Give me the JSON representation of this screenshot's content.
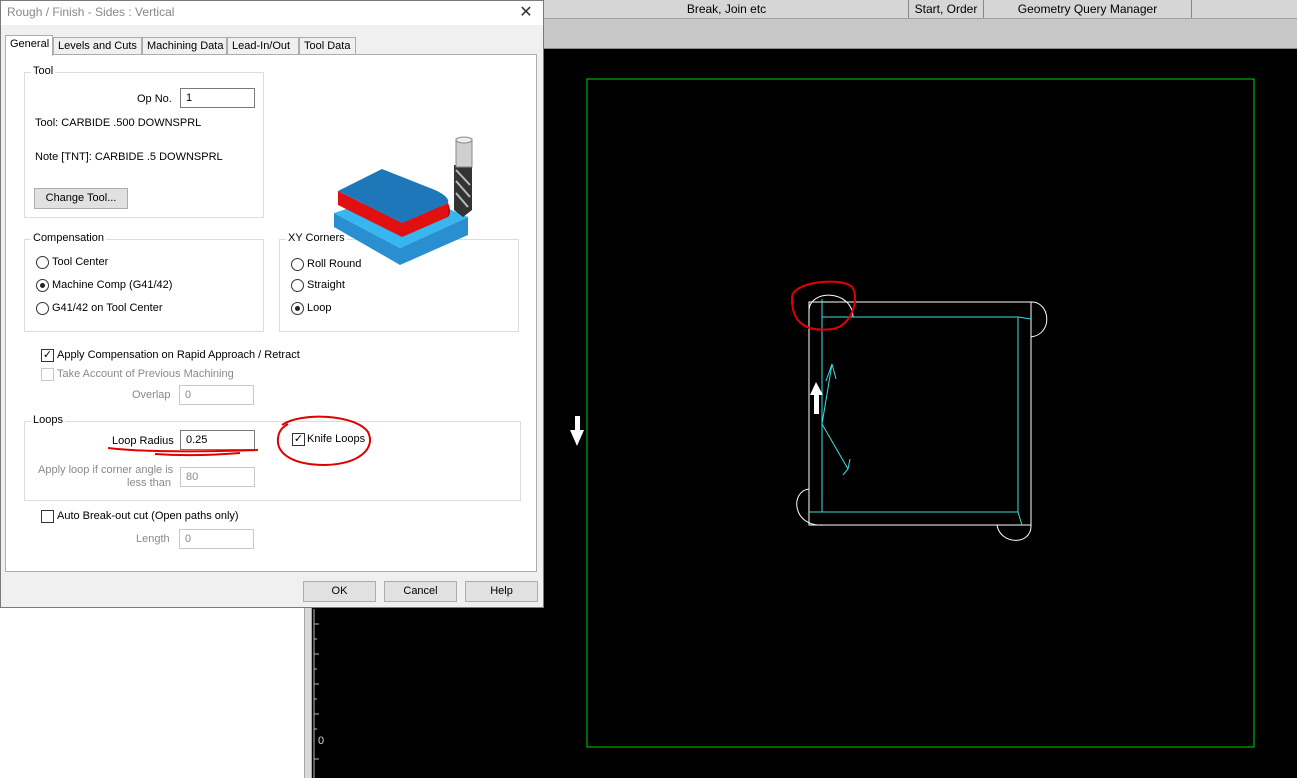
{
  "dialog": {
    "title": "Rough / Finish - Sides : Vertical",
    "close_glyph": "✕",
    "tabs": [
      {
        "label": "General"
      },
      {
        "label": "Levels and Cuts"
      },
      {
        "label": "Machining Data"
      },
      {
        "label": "Lead-In/Out"
      },
      {
        "label": "Tool Data"
      }
    ],
    "tool_group": {
      "title": "Tool",
      "op_no_label": "Op No.",
      "op_no_value": "1",
      "tool_line": "Tool: CARBIDE .500 DOWNSPRL",
      "note_line": "Note [TNT]: CARBIDE .5 DOWNSPRL",
      "change_tool_button": "Change Tool..."
    },
    "compensation": {
      "title": "Compensation",
      "options": [
        "Tool Center",
        "Machine Comp (G41/42)",
        "G41/42 on Tool Center"
      ],
      "selected": "Machine Comp (G41/42)"
    },
    "xy_corners": {
      "title": "XY Corners",
      "options": [
        "Roll Round",
        "Straight",
        "Loop"
      ],
      "selected": "Loop"
    },
    "apply_comp_label": "Apply Compensation on Rapid Approach / Retract",
    "apply_comp_checked": true,
    "take_account_label": "Take Account of Previous Machining",
    "take_account_checked": false,
    "overlap_label": "Overlap",
    "overlap_value": "0",
    "loops": {
      "title": "Loops",
      "loop_radius_label": "Loop Radius",
      "loop_radius_value": "0.25",
      "knife_loops_label": "Knife Loops",
      "knife_loops_checked": true,
      "apply_loop_label_1": "Apply loop if corner angle is",
      "apply_loop_label_2": "less than",
      "apply_loop_value": "80"
    },
    "auto_breakout_label": "Auto Break-out cut (Open paths only)",
    "auto_breakout_checked": false,
    "length_label": "Length",
    "length_value": "0",
    "buttons": {
      "ok": "OK",
      "cancel": "Cancel",
      "help": "Help"
    }
  },
  "app": {
    "toolbar": [
      "Break, Join etc",
      "Start, Order",
      "Geometry Query Manager"
    ],
    "ruler_zero": "0"
  },
  "colors": {
    "canvas_bg": "#000000",
    "boundary": "#00d400",
    "geometry": "#ffffff",
    "toolpath": "#38e0e0",
    "annotation": "#e00000"
  }
}
